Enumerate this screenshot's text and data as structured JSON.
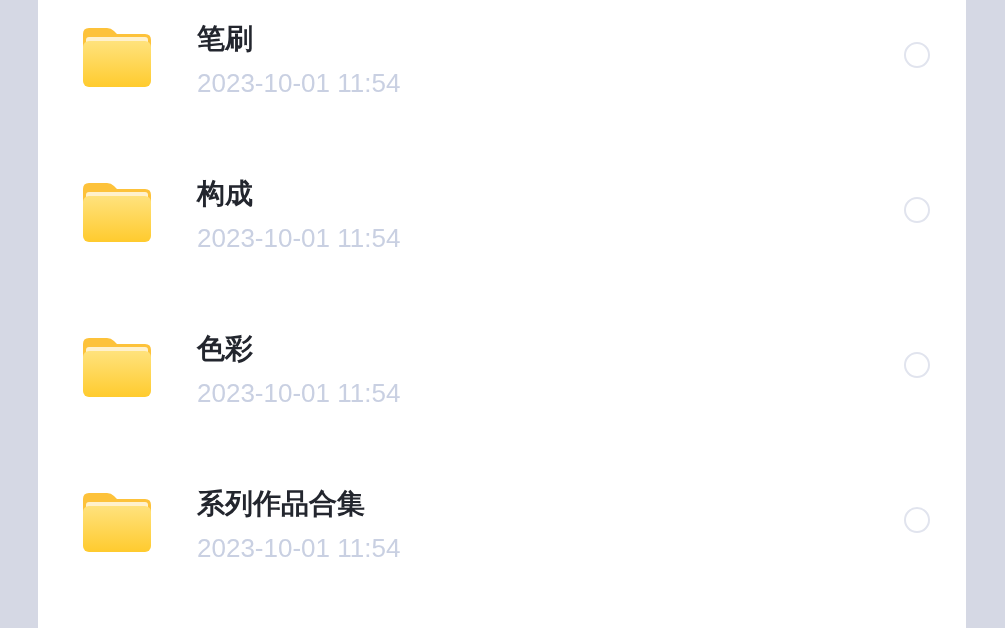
{
  "items": [
    {
      "name": "笔刷",
      "date": "2023-10-01 11:54",
      "selected": false
    },
    {
      "name": "构成",
      "date": "2023-10-01 11:54",
      "selected": false
    },
    {
      "name": "色彩",
      "date": "2023-10-01 11:54",
      "selected": false
    },
    {
      "name": "系列作品合集",
      "date": "2023-10-01 11:54",
      "selected": false
    }
  ]
}
